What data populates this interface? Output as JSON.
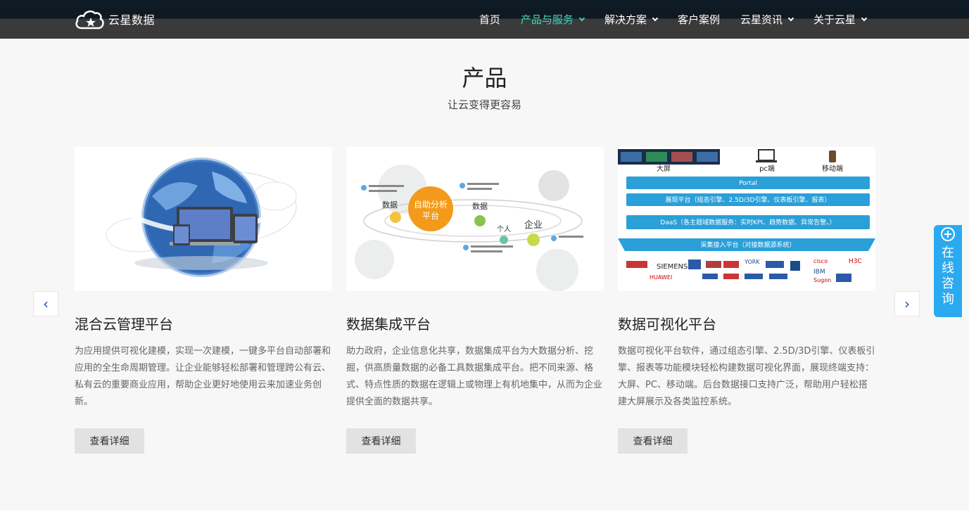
{
  "header": {
    "logo_text": "云星数据",
    "nav": [
      {
        "label": "首页",
        "has_dropdown": false,
        "active": false
      },
      {
        "label": "产品与服务",
        "has_dropdown": true,
        "active": true
      },
      {
        "label": "解决方案",
        "has_dropdown": true,
        "active": false
      },
      {
        "label": "客户案例",
        "has_dropdown": false,
        "active": false
      },
      {
        "label": "云星资讯",
        "has_dropdown": true,
        "active": false
      },
      {
        "label": "关于云星",
        "has_dropdown": true,
        "active": false
      }
    ]
  },
  "section": {
    "title": "产品",
    "subtitle": "让云变得更容易"
  },
  "cards": [
    {
      "title": "混合云管理平台",
      "desc": "为应用提供可视化建模，实现一次建模，一键多平台自动部署和应用的全生命周期管理。让企业能够轻松部署和管理跨公有云、私有云的重要商业应用，帮助企业更好地使用云来加速业务创新。",
      "button": "查看详细"
    },
    {
      "title": "数据集成平台",
      "desc": "助力政府，企业信息化共享，数据集成平台为大数据分析、挖掘，供高质量数据的必备工具数据集成平台。把不同来源、格式、特点性质的数据在逻辑上或物理上有机地集中，从而为企业提供全面的数据共享。",
      "button": "查看详细"
    },
    {
      "title": "数据可视化平台",
      "desc": "数据可视化平台软件，通过组态引擎、2.5D/3D引擎、仪表板引擎、报表等功能模块轻松构建数据可视化界面，展现终端支持：大屏、PC、移动端。后台数据接口支持广泛，帮助用户轻松搭建大屏展示及各类监控系统。",
      "button": "查看详细"
    }
  ],
  "images": {
    "integration": {
      "data1": "数据",
      "center": "自助分析平台",
      "data2": "数据",
      "person": "个人",
      "enterprise": "企业"
    },
    "visual": {
      "device1": "大屏",
      "device2": "pc端",
      "device3": "移动端",
      "layers": [
        "Portal",
        "展现平台（组态引擎、2.5D/3D引擎、仪表板引擎、报表）",
        "DaaS（各主题域数据服务：实时KPI、趋势数据、异常告警。）",
        "采集接入平台（对接数据源系统）"
      ],
      "logos": [
        "SIEMENS",
        "HUAWEI",
        "YORK",
        "IBM",
        "H3C",
        "Sugon",
        "cisco"
      ]
    }
  },
  "consult": {
    "label": "在线咨询"
  },
  "arrows": {
    "prev": "‹",
    "next": "›"
  },
  "colors": {
    "accent": "#3fd7b9",
    "consult_bg": "#2aaaf0",
    "arrow": "#1f4fa0"
  }
}
